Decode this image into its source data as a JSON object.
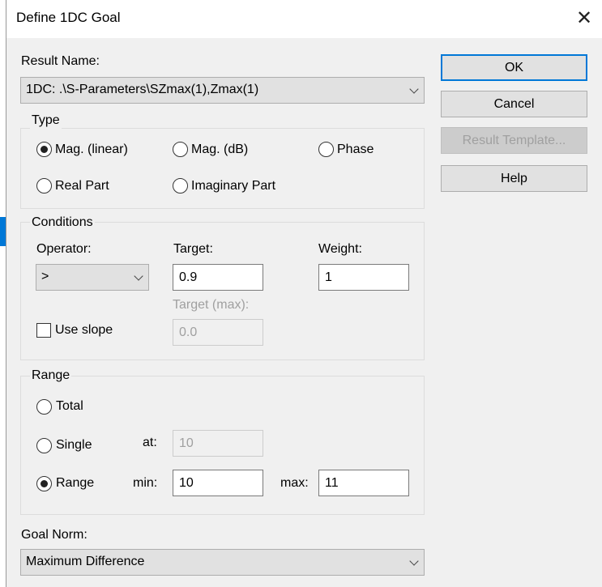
{
  "dialog": {
    "title": "Define 1DC Goal",
    "close_icon": "close-icon"
  },
  "result_name": {
    "label": "Result Name:",
    "value": "1DC: .\\S-Parameters\\SZmax(1),Zmax(1)"
  },
  "type": {
    "legend": "Type",
    "options": [
      {
        "label": "Mag. (linear)",
        "selected": true
      },
      {
        "label": "Mag. (dB)",
        "selected": false
      },
      {
        "label": "Phase",
        "selected": false
      },
      {
        "label": "Real Part",
        "selected": false
      },
      {
        "label": "Imaginary Part",
        "selected": false
      }
    ]
  },
  "conditions": {
    "legend": "Conditions",
    "operator_label": "Operator:",
    "operator_value": ">",
    "target_label": "Target:",
    "target_value": "0.9",
    "weight_label": "Weight:",
    "weight_value": "1",
    "target_max_label": "Target (max):",
    "target_max_value": "0.0",
    "use_slope_label": "Use slope",
    "use_slope_checked": false
  },
  "range": {
    "legend": "Range",
    "total_label": "Total",
    "single_label": "Single",
    "range_label": "Range",
    "selected": "Range",
    "at_label": "at:",
    "at_value": "10",
    "min_label": "min:",
    "min_value": "10",
    "max_label": "max:",
    "max_value": "11"
  },
  "goal_norm": {
    "label": "Goal Norm:",
    "value": "Maximum Difference"
  },
  "buttons": {
    "ok": "OK",
    "cancel": "Cancel",
    "result_template": "Result Template...",
    "help": "Help"
  },
  "colors": {
    "accent": "#0078d7",
    "background": "#f0f0f0"
  }
}
